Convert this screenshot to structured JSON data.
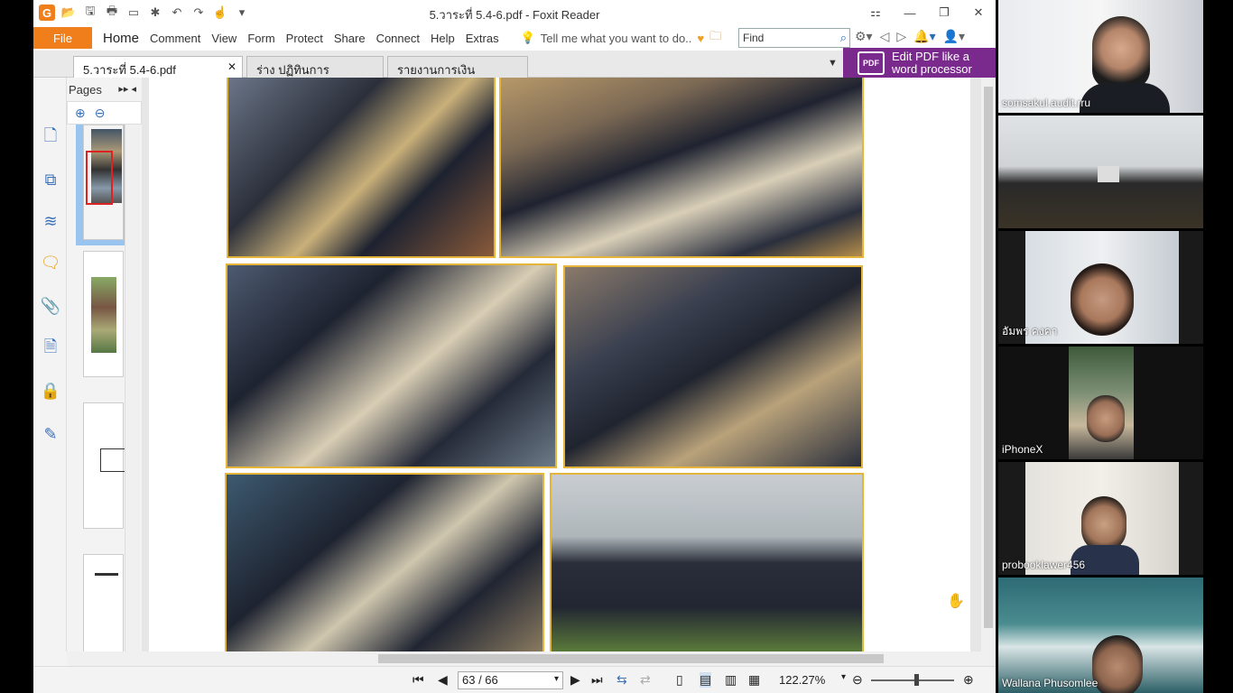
{
  "window": {
    "title": "5.วาระที่ 5.4-6.pdf - Foxit Reader"
  },
  "menu": {
    "file": "File",
    "items": [
      "Home",
      "Comment",
      "View",
      "Form",
      "Protect",
      "Share",
      "Connect",
      "Help",
      "Extras"
    ],
    "tell_me": "Tell me what you want to do..",
    "find_placeholder": "Find"
  },
  "tabs": [
    {
      "label": "5.วาระที่ 5.4-6.pdf"
    },
    {
      "label": "ร่าง ปฏิทินการประชุม.pdf"
    },
    {
      "label": "รายงานการเงินสวัสดิการ ..."
    }
  ],
  "ad": {
    "logo": "PDF",
    "line1": "Edit PDF like a",
    "line2": "word processor"
  },
  "pages_panel": {
    "title": "Pages"
  },
  "status": {
    "page_value": "63 / 66",
    "zoom": "122.27%"
  },
  "participants": [
    {
      "name": "somsakul.audit.rru"
    },
    {
      "name": ""
    },
    {
      "name": "อัมพร  คงคา"
    },
    {
      "name": "iPhoneX"
    },
    {
      "name": "probooklawer456"
    },
    {
      "name": "Wallana Phusomlee"
    }
  ]
}
